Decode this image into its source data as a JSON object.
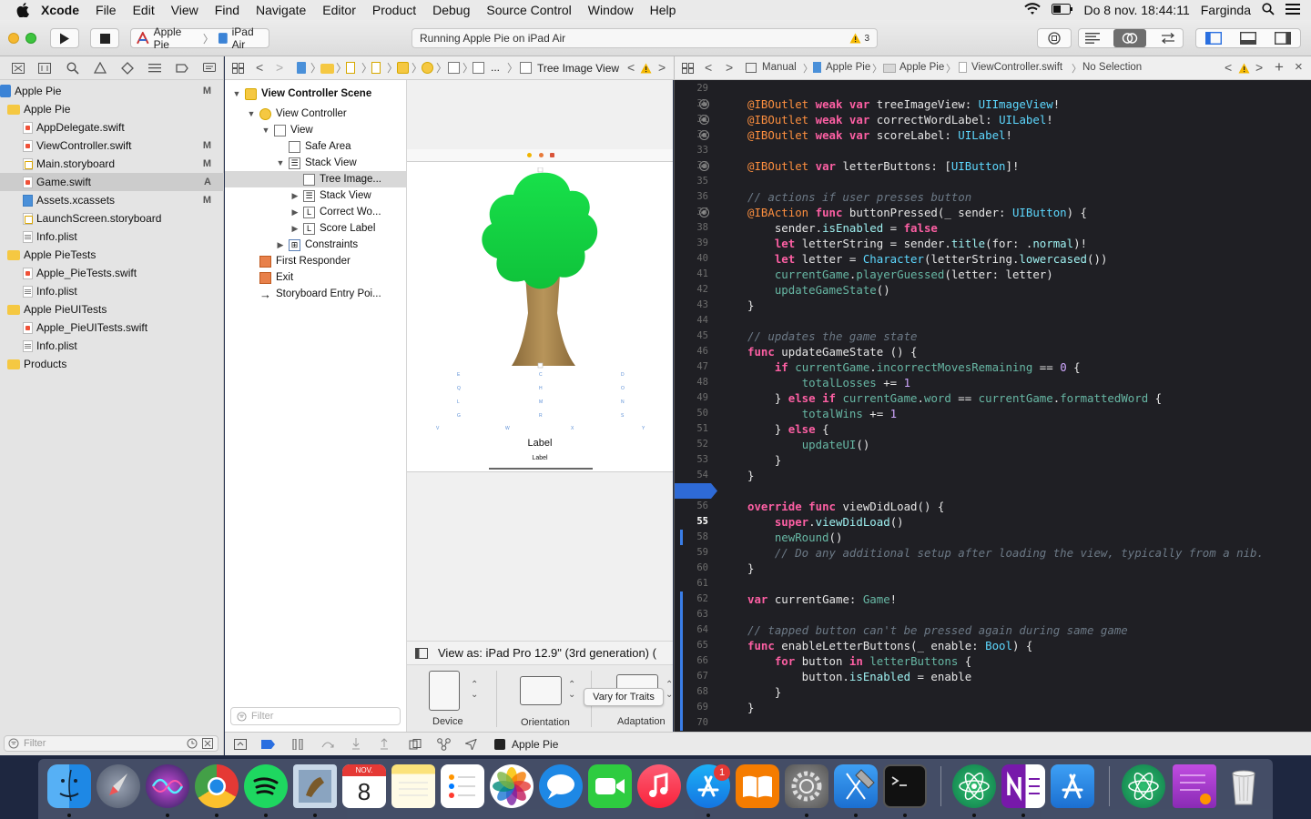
{
  "menubar": {
    "app_name": "Xcode",
    "items": [
      "File",
      "Edit",
      "View",
      "Find",
      "Navigate",
      "Editor",
      "Product",
      "Debug",
      "Source Control",
      "Window",
      "Help"
    ],
    "clock": "Do 8 nov.  18:44:11",
    "user": "Farginda"
  },
  "toolbar": {
    "scheme_name": "Apple Pie",
    "device_name": "iPad Air",
    "activity_text": "Running Apple Pie on iPad Air",
    "warning_count": "3"
  },
  "navigator": {
    "items": [
      {
        "label": "Apple Pie",
        "badge": "M"
      },
      {
        "label": "Apple Pie",
        "badge": ""
      },
      {
        "label": "AppDelegate.swift",
        "badge": ""
      },
      {
        "label": "ViewController.swift",
        "badge": "M"
      },
      {
        "label": "Main.storyboard",
        "badge": "M"
      },
      {
        "label": "Game.swift",
        "badge": "A"
      },
      {
        "label": "Assets.xcassets",
        "badge": "M"
      },
      {
        "label": "LaunchScreen.storyboard",
        "badge": ""
      },
      {
        "label": "Info.plist",
        "badge": ""
      },
      {
        "label": "Apple PieTests",
        "badge": ""
      },
      {
        "label": "Apple_PieTests.swift",
        "badge": ""
      },
      {
        "label": "Info.plist",
        "badge": ""
      },
      {
        "label": "Apple PieUITests",
        "badge": ""
      },
      {
        "label": "Apple_PieUITests.swift",
        "badge": ""
      },
      {
        "label": "Info.plist",
        "badge": ""
      },
      {
        "label": "Products",
        "badge": ""
      }
    ],
    "filter_placeholder": "Filter"
  },
  "storyboard": {
    "jump_title": "Tree Image View",
    "jump_ellipsis": "...",
    "outline": [
      "View Controller Scene",
      "View Controller",
      "View",
      "Safe Area",
      "Stack View",
      "Tree Image...",
      "Stack View",
      "Correct Wo...",
      "Score Label",
      "Constraints",
      "First Responder",
      "Exit",
      "Storyboard Entry Poi..."
    ],
    "outline_filter_placeholder": "Filter",
    "scene_label_big": "Label",
    "scene_label_small": "Label",
    "view_as": "View as: iPad Pro 12.9\" (3rd generation) (",
    "traits": {
      "device": "Device",
      "orientation": "Orientation",
      "adaptation": "Adaptation",
      "vary_button": "Vary for Traits"
    }
  },
  "editor": {
    "breadcrumb": [
      "Manual",
      "Apple Pie",
      "Apple Pie",
      "ViewController.swift",
      "No Selection"
    ],
    "current_line": "55"
  },
  "debugbar": {
    "target": "Apple Pie"
  },
  "dock": {
    "apps": [
      "Finder",
      "Launchpad",
      "Siri",
      "Chrome",
      "Spotify",
      "Preview",
      "Calendar",
      "Notes",
      "Reminders",
      "Photos",
      "Messages",
      "FaceTime",
      "Music",
      "App Store",
      "Books",
      "System Preferences",
      "Xcode",
      "Terminal",
      "Atom",
      "OneNote",
      "Xcode Tools",
      "Atom",
      "Stickies",
      "Trash"
    ],
    "calendar_month": "NOV.",
    "calendar_day": "8",
    "appstore_badge": "1"
  },
  "colors": {
    "accent": "#3a7ee8",
    "editor_bg": "#1f1f24",
    "keyword": "#fc5fa3",
    "comment": "#6c7986",
    "type": "#5dd8ff"
  }
}
